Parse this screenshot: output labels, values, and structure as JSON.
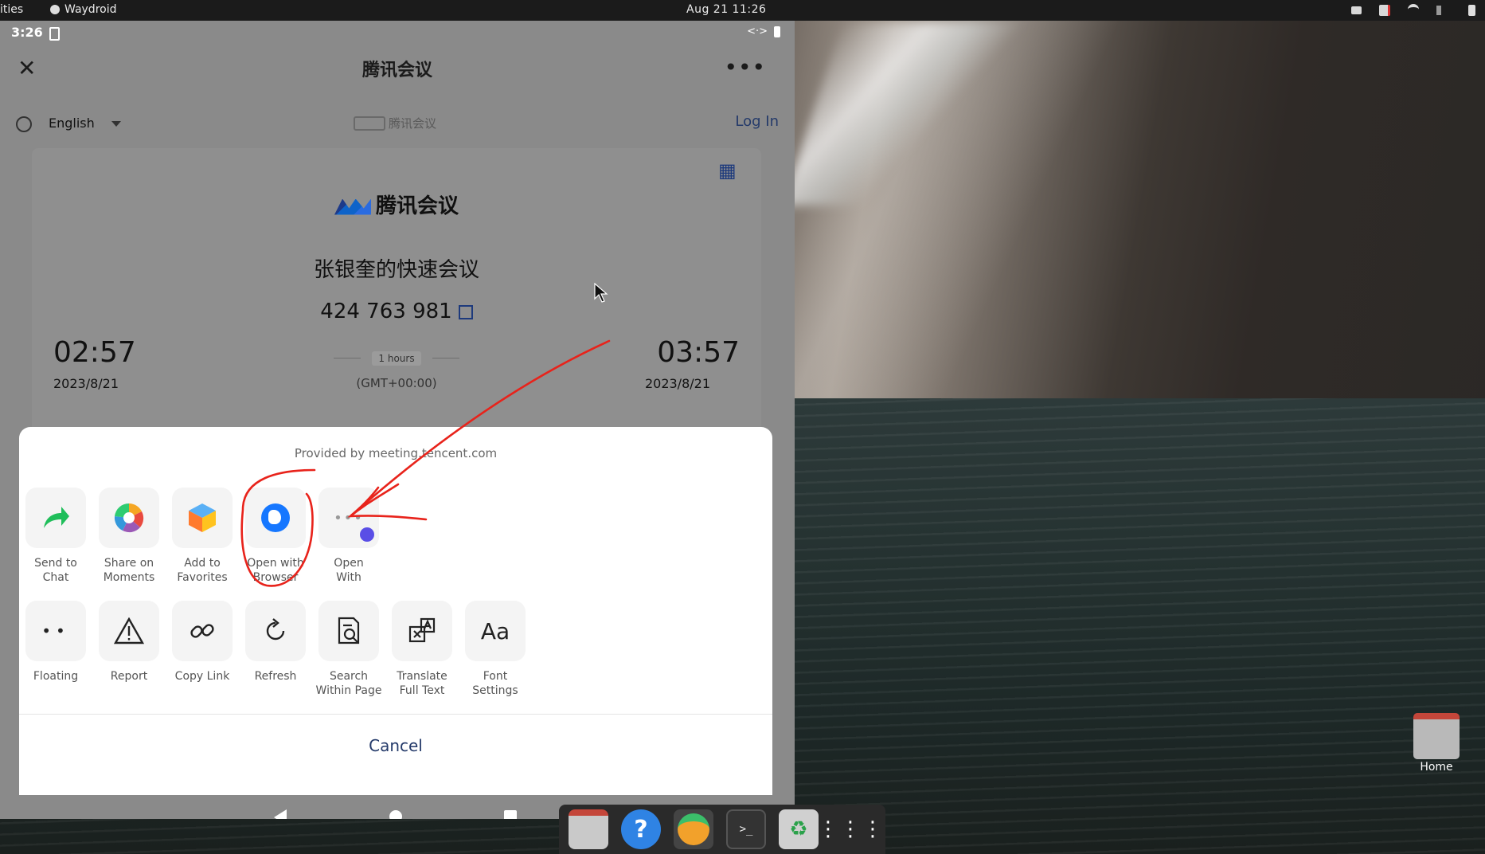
{
  "topbar": {
    "activities": "ities",
    "app_name": "Waydroid",
    "clock": "Aug 21  11:26"
  },
  "android_status": {
    "time": "3:26"
  },
  "webview": {
    "title": "腾讯会议",
    "language": "English",
    "brand_small": "腾讯会议",
    "login": "Log In"
  },
  "meeting": {
    "brand": "腾讯会议",
    "title": "张银奎的快速会议",
    "id": "424 763 981",
    "start_time": "02:57",
    "start_date": "2023/8/21",
    "end_time": "03:57",
    "end_date": "2023/8/21",
    "duration": "1 hours",
    "timezone": "(GMT+00:00)"
  },
  "sheet": {
    "provided_by": "Provided by meeting.tencent.com",
    "row1": [
      {
        "label1": "Send to",
        "label2": "Chat"
      },
      {
        "label1": "Share on",
        "label2": "Moments"
      },
      {
        "label1": "Add to",
        "label2": "Favorites"
      },
      {
        "label1": "Open with",
        "label2": "Browser"
      },
      {
        "label1": "Open",
        "label2": "With"
      }
    ],
    "row2": [
      {
        "label1": "Floating",
        "label2": ""
      },
      {
        "label1": "Report",
        "label2": ""
      },
      {
        "label1": "Copy Link",
        "label2": ""
      },
      {
        "label1": "Refresh",
        "label2": ""
      },
      {
        "label1": "Search",
        "label2": "Within Page"
      },
      {
        "label1": "Translate",
        "label2": "Full Text"
      },
      {
        "label1": "Font",
        "label2": "Settings"
      }
    ],
    "font_icon_text": "Aa",
    "cancel": "Cancel"
  },
  "desktop": {
    "home_label": "Home"
  },
  "colors": {
    "accent": "#243a6a",
    "annotation": "#e8231b",
    "globe_blue": "#1677ff"
  }
}
